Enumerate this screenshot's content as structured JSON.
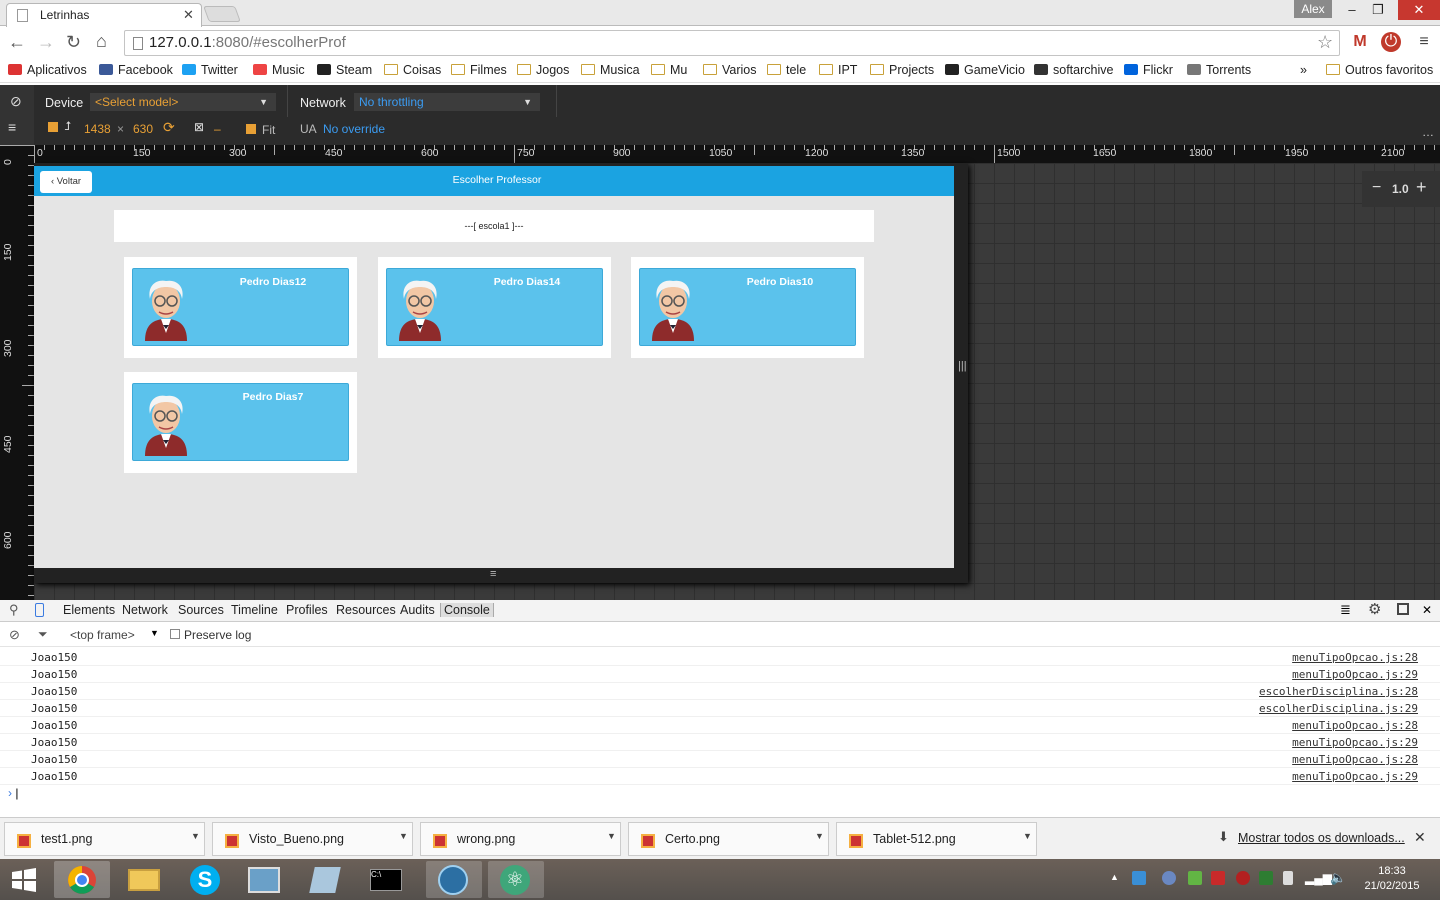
{
  "window": {
    "user": "Alex"
  },
  "tab": {
    "title": "Letrinhas"
  },
  "omnibox": {
    "host": "127.0.0.1",
    "rest": ":8080/#escolherProf"
  },
  "bookmarks": [
    "Aplicativos",
    "Facebook",
    "Twitter",
    "Music",
    "Steam",
    "Coisas",
    "Filmes",
    "Jogos",
    "Musica",
    "Mu",
    "Varios",
    "tele",
    "IPT",
    "Projects",
    "GameVicio",
    "softarchive",
    "Flickr",
    "Torrents"
  ],
  "bookmarks_more": "»",
  "bookmarks_other": "Outros favoritos",
  "device": {
    "device_label": "Device",
    "model": "<Select model>",
    "network_label": "Network",
    "network": "No throttling",
    "width": "1438",
    "times": "×",
    "height": "630",
    "dash": "–",
    "fit": "Fit",
    "ua_label": "UA",
    "ua": "No override"
  },
  "ruler_h": [
    "0",
    "150",
    "300",
    "450",
    "600",
    "750",
    "900",
    "1050",
    "1200",
    "1350",
    "1500",
    "1650",
    "1800",
    "1950",
    "2100"
  ],
  "ruler_v": [
    "0",
    "150",
    "300",
    "450",
    "600"
  ],
  "zoom": {
    "value": "1.0",
    "minus": "−",
    "plus": "+"
  },
  "app": {
    "back": "Voltar",
    "title": "Escolher Professor",
    "school": "---[ escola1 ]---",
    "teachers": [
      "Pedro Dias12",
      "Pedro Dias14",
      "Pedro Dias10",
      "Pedro Dias7"
    ]
  },
  "devtools": {
    "tabs": [
      "Elements",
      "Network",
      "Sources",
      "Timeline",
      "Profiles",
      "Resources",
      "Audits",
      "Console"
    ],
    "frame": "<top frame>",
    "preserve_log": "Preserve log",
    "logs": [
      {
        "msg": "Joao150",
        "src": "menuTipoOpcao.js:28"
      },
      {
        "msg": "Joao150",
        "src": "menuTipoOpcao.js:29"
      },
      {
        "msg": "Joao150",
        "src": "escolherDisciplina.js:28"
      },
      {
        "msg": "Joao150",
        "src": "escolherDisciplina.js:29"
      },
      {
        "msg": "Joao150",
        "src": "menuTipoOpcao.js:28"
      },
      {
        "msg": "Joao150",
        "src": "menuTipoOpcao.js:29"
      },
      {
        "msg": "Joao150",
        "src": "menuTipoOpcao.js:28"
      },
      {
        "msg": "Joao150",
        "src": "menuTipoOpcao.js:29"
      }
    ]
  },
  "downloads": {
    "files": [
      "test1.png",
      "Visto_Bueno.png",
      "wrong.png",
      "Certo.png",
      "Tablet-512.png"
    ],
    "show_all": "Mostrar todos os downloads..."
  },
  "taskbar": {
    "time": "18:33",
    "date": "21/02/2015"
  }
}
